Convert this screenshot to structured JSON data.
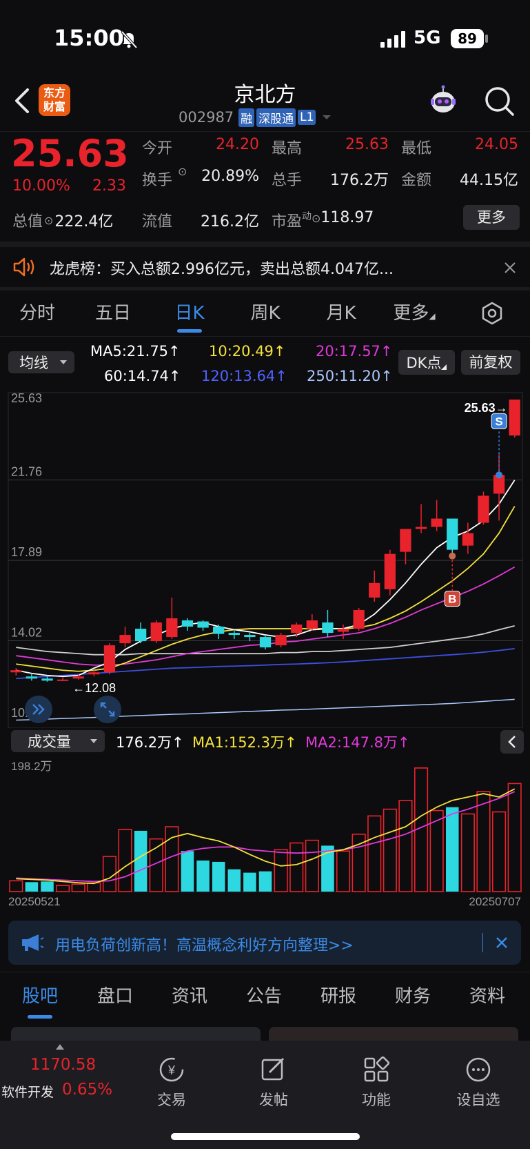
{
  "status_bar": {
    "time": "15:00",
    "network": "5G",
    "battery": "89"
  },
  "header": {
    "logo_line1": "东方",
    "logo_line2": "财富",
    "stock_name": "京北方",
    "stock_code": "002987",
    "badges": [
      "融",
      "深股通",
      "L1"
    ]
  },
  "quote": {
    "price": "25.63",
    "change_pct": "10.00%",
    "change_amt": "2.33",
    "rows": [
      [
        {
          "label": "今开",
          "value": "24.20",
          "red": true
        },
        {
          "label": "最高",
          "value": "25.63",
          "red": true
        },
        {
          "label": "最低",
          "value": "24.05",
          "red": true
        }
      ],
      [
        {
          "label": "换手",
          "value": "20.89%",
          "red": false
        },
        {
          "label": "总手",
          "value": "176.2万",
          "red": false
        },
        {
          "label": "金额",
          "value": "44.15亿",
          "red": false
        }
      ]
    ],
    "total_value_label": "总值",
    "total_value": "222.4亿",
    "float_value_label": "流值",
    "float_value": "216.2亿",
    "pe_label": "市盈",
    "pe_sup": "动",
    "pe_value": "118.97",
    "more_button": "更多"
  },
  "notice": {
    "text": "龙虎榜：买入总额2.996亿元，卖出总额4.047亿..."
  },
  "chart_tabs": [
    "分时",
    "五日",
    "日K",
    "周K",
    "月K",
    "更多"
  ],
  "active_tab": 2,
  "ma_bar": {
    "selector": "均线",
    "ma5": "MA5:21.75↑",
    "ma10": "10:20.49↑",
    "ma20": "20:17.57↑",
    "ma60": "60:14.74↑",
    "ma120": "120:13.64↑",
    "ma250": "250:11.20↑",
    "dk_button": "DK点",
    "adjust_button": "前复权"
  },
  "colors": {
    "up": "#e8232c",
    "down": "#2ed8e0",
    "ma5": "#ffffff",
    "ma10": "#f5e23c",
    "ma20": "#e03ad8",
    "ma60": "#cfcfcf",
    "ma120": "#3c4fe0",
    "ma250": "#aac8ff"
  },
  "volume_bar": {
    "selector": "成交量",
    "vol": "176.2万↑",
    "ma1": "MA1:152.3万↑",
    "ma2": "MA2:147.8万↑",
    "axis_top": "198.2万"
  },
  "chart_data": {
    "type": "candlestick",
    "y_ticks": [
      "25.63",
      "21.76",
      "17.89",
      "14.02",
      "10.15"
    ],
    "ylim": [
      10.15,
      25.63
    ],
    "x_labels": [
      "20250521",
      "20250707"
    ],
    "max_label": "25.63→",
    "min_label": "←12.08",
    "markers": [
      {
        "label": "S",
        "index": 31
      },
      {
        "label": "B",
        "index": 28
      }
    ],
    "candles": [
      [
        12.5,
        12.6,
        12.35,
        12.7
      ],
      [
        12.3,
        12.2,
        12.1,
        12.45
      ],
      [
        12.2,
        12.1,
        12.05,
        12.3
      ],
      [
        12.1,
        12.15,
        12.08,
        12.25
      ],
      [
        12.2,
        12.3,
        12.15,
        12.4
      ],
      [
        12.4,
        12.5,
        12.3,
        12.6
      ],
      [
        12.5,
        13.8,
        12.4,
        13.9
      ],
      [
        13.9,
        14.3,
        13.7,
        14.7
      ],
      [
        14.6,
        14.0,
        13.9,
        14.9
      ],
      [
        14.0,
        14.9,
        13.9,
        15.0
      ],
      [
        14.2,
        15.1,
        14.1,
        16.1
      ],
      [
        15.0,
        14.7,
        14.5,
        15.1
      ],
      [
        14.95,
        14.65,
        14.5,
        15.0
      ],
      [
        14.7,
        14.35,
        14.1,
        14.8
      ],
      [
        14.4,
        14.3,
        14.1,
        14.5
      ],
      [
        14.3,
        14.2,
        14.0,
        14.4
      ],
      [
        14.2,
        13.7,
        13.6,
        14.3
      ],
      [
        13.8,
        14.3,
        13.7,
        14.4
      ],
      [
        14.4,
        14.8,
        14.2,
        14.9
      ],
      [
        14.6,
        15.0,
        14.5,
        15.3
      ],
      [
        14.9,
        14.4,
        14.2,
        15.5
      ],
      [
        14.45,
        14.6,
        14.1,
        14.8
      ],
      [
        14.6,
        15.5,
        14.5,
        15.6
      ],
      [
        16.1,
        16.8,
        15.9,
        17.4
      ],
      [
        16.5,
        18.2,
        16.2,
        18.4
      ],
      [
        18.3,
        19.4,
        17.7,
        19.4
      ],
      [
        19.4,
        19.5,
        19.2,
        20.6
      ],
      [
        19.5,
        19.9,
        19.3,
        20.8
      ],
      [
        19.9,
        18.4,
        18.1,
        19.6
      ],
      [
        18.6,
        19.2,
        18.2,
        19.7
      ],
      [
        19.7,
        21.0,
        19.6,
        21.2
      ],
      [
        21.1,
        22.0,
        19.8,
        23.0
      ],
      [
        23.9,
        25.63,
        23.8,
        25.63
      ]
    ],
    "ma5": [
      12.6,
      12.45,
      12.35,
      12.3,
      12.35,
      12.7,
      13.0,
      13.6,
      14.0,
      14.3,
      14.6,
      14.8,
      14.9,
      14.7,
      14.55,
      14.45,
      14.3,
      14.2,
      14.3,
      14.55,
      14.6,
      14.6,
      14.8,
      15.3,
      16.0,
      16.8,
      17.7,
      18.5,
      19.0,
      19.3,
      19.8,
      20.6,
      21.75
    ],
    "ma10": [
      12.9,
      12.8,
      12.7,
      12.6,
      12.55,
      12.6,
      12.7,
      12.95,
      13.25,
      13.55,
      13.85,
      14.1,
      14.3,
      14.45,
      14.55,
      14.6,
      14.6,
      14.6,
      14.6,
      14.6,
      14.6,
      14.6,
      14.65,
      14.8,
      15.1,
      15.45,
      15.9,
      16.4,
      16.9,
      17.5,
      18.2,
      19.2,
      20.49
    ],
    "ma20": [
      13.3,
      13.2,
      13.1,
      13.0,
      12.9,
      12.85,
      12.85,
      12.9,
      13.0,
      13.1,
      13.25,
      13.4,
      13.5,
      13.6,
      13.7,
      13.8,
      13.85,
      13.95,
      14.0,
      14.1,
      14.2,
      14.3,
      14.4,
      14.6,
      14.85,
      15.15,
      15.5,
      15.8,
      16.1,
      16.4,
      16.75,
      17.15,
      17.57
    ],
    "ma60": [
      13.7,
      13.6,
      13.5,
      13.45,
      13.4,
      13.35,
      13.35,
      13.35,
      13.4,
      13.4,
      13.4,
      13.4,
      13.4,
      13.4,
      13.4,
      13.4,
      13.4,
      13.45,
      13.45,
      13.5,
      13.5,
      13.55,
      13.6,
      13.65,
      13.7,
      13.8,
      13.9,
      14.0,
      14.1,
      14.2,
      14.35,
      14.55,
      14.74
    ],
    "ma120": [
      12.2,
      12.25,
      12.3,
      12.35,
      12.4,
      12.45,
      12.5,
      12.55,
      12.6,
      12.65,
      12.7,
      12.72,
      12.75,
      12.78,
      12.8,
      12.82,
      12.85,
      12.88,
      12.9,
      12.93,
      12.96,
      13.0,
      13.05,
      13.1,
      13.15,
      13.2,
      13.25,
      13.3,
      13.35,
      13.4,
      13.47,
      13.55,
      13.64
    ],
    "ma250": [
      10.2,
      10.22,
      10.25,
      10.28,
      10.3,
      10.33,
      10.36,
      10.39,
      10.42,
      10.45,
      10.48,
      10.5,
      10.53,
      10.56,
      10.59,
      10.62,
      10.65,
      10.68,
      10.7,
      10.73,
      10.76,
      10.79,
      10.82,
      10.85,
      10.88,
      10.91,
      10.94,
      10.97,
      11.0,
      11.05,
      11.1,
      11.15,
      11.2
    ],
    "volume": [
      16,
      14,
      15,
      9,
      11,
      13,
      52,
      92,
      90,
      78,
      96,
      60,
      46,
      44,
      33,
      28,
      30,
      62,
      72,
      76,
      68,
      60,
      85,
      112,
      122,
      135,
      183,
      120,
      125,
      115,
      148,
      118,
      160
    ],
    "vol_ma1": [
      19,
      18,
      17,
      15,
      13,
      12,
      20,
      37,
      52,
      65,
      80,
      86,
      80,
      75,
      66,
      55,
      45,
      38,
      40,
      48,
      58,
      62,
      70,
      80,
      88,
      96,
      112,
      125,
      135,
      140,
      145,
      140,
      152
    ],
    "vol_ma2": [
      20,
      19,
      18,
      17,
      16,
      15,
      16,
      22,
      32,
      42,
      52,
      60,
      64,
      66,
      66,
      62,
      60,
      58,
      57,
      58,
      60,
      62,
      66,
      72,
      78,
      85,
      95,
      105,
      115,
      122,
      130,
      138,
      148
    ],
    "vol_max": 198.2
  },
  "ad": {
    "text": "用电负荷创新高！高温概念利好方向整理>>"
  },
  "bottom_tabs": [
    "股吧",
    "盘口",
    "资讯",
    "公告",
    "研报",
    "财务",
    "资料"
  ],
  "active_bottom_tab": 0,
  "footer": {
    "index_value": "1170.58",
    "sector_name": "软件开发",
    "sector_pct": "0.65%",
    "nav": [
      {
        "label": "交易",
        "icon": "yen-icon"
      },
      {
        "label": "发帖",
        "icon": "edit-icon"
      },
      {
        "label": "功能",
        "icon": "grid-icon"
      },
      {
        "label": "设自选",
        "icon": "more-icon"
      }
    ]
  }
}
